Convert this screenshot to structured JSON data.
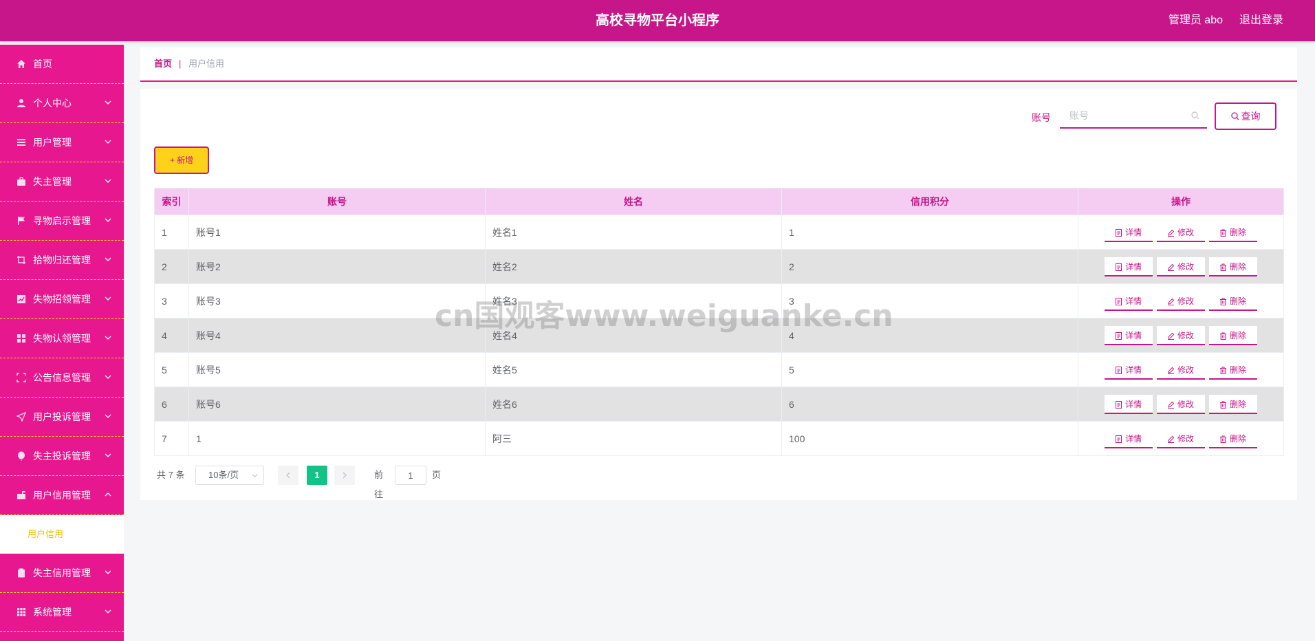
{
  "header": {
    "title": "高校寻物平台小程序",
    "user": "管理员 abo",
    "logout": "退出登录"
  },
  "sidebar": {
    "items": [
      {
        "label": "首页",
        "icon": "home-icon",
        "expandable": false
      },
      {
        "label": "个人中心",
        "icon": "user-icon",
        "expandable": true
      },
      {
        "label": "用户管理",
        "icon": "list-icon",
        "expandable": true
      },
      {
        "label": "失主管理",
        "icon": "briefcase-icon",
        "expandable": true
      },
      {
        "label": "寻物启示管理",
        "icon": "flag-icon",
        "expandable": true
      },
      {
        "label": "拾物归还管理",
        "icon": "crop-icon",
        "expandable": true
      },
      {
        "label": "失物招领管理",
        "icon": "chart-icon",
        "expandable": true
      },
      {
        "label": "失物认领管理",
        "icon": "grid-icon",
        "expandable": true
      },
      {
        "label": "公告信息管理",
        "icon": "fullscreen-icon",
        "expandable": true
      },
      {
        "label": "用户投诉管理",
        "icon": "send-icon",
        "expandable": true
      },
      {
        "label": "失主投诉管理",
        "icon": "balloon-icon",
        "expandable": true
      },
      {
        "label": "用户信用管理",
        "icon": "mailbox-icon",
        "expandable": true,
        "open": true
      }
    ],
    "submenu": {
      "label": "用户信用"
    },
    "items_after": [
      {
        "label": "失主信用管理",
        "icon": "clipboard-icon",
        "expandable": true
      },
      {
        "label": "系统管理",
        "icon": "apps-icon",
        "expandable": true
      }
    ]
  },
  "breadcrumb": {
    "home": "首页",
    "separator": "|",
    "current": "用户信用"
  },
  "search": {
    "label": "账号",
    "placeholder": "账号",
    "value": "",
    "button": "查询"
  },
  "add_button": "+ 新增",
  "table": {
    "headers": [
      "索引",
      "账号",
      "姓名",
      "信用积分",
      "操作"
    ],
    "rows": [
      {
        "index": "1",
        "account": "账号1",
        "name": "姓名1",
        "score": "1"
      },
      {
        "index": "2",
        "account": "账号2",
        "name": "姓名2",
        "score": "2"
      },
      {
        "index": "3",
        "account": "账号3",
        "name": "姓名3",
        "score": "3"
      },
      {
        "index": "4",
        "account": "账号4",
        "name": "姓名4",
        "score": "4"
      },
      {
        "index": "5",
        "account": "账号5",
        "name": "姓名5",
        "score": "5"
      },
      {
        "index": "6",
        "account": "账号6",
        "name": "姓名6",
        "score": "6"
      },
      {
        "index": "7",
        "account": "1",
        "name": "阿三",
        "score": "100"
      }
    ],
    "actions": {
      "detail": "详情",
      "edit": "修改",
      "delete": "删除"
    }
  },
  "pagination": {
    "total": "共 7 条",
    "page_size": "10条/页",
    "current_page": "1",
    "goto_label": "前往",
    "goto_value": "1",
    "goto_unit": "页"
  },
  "watermark": "cn国观客www.weiguanke.cn",
  "colors": {
    "primary": "#c7158a",
    "sidebar": "#e6178f",
    "accent": "#ffd21a",
    "header_row": "#f5cdf3",
    "page_active": "#12c287"
  }
}
